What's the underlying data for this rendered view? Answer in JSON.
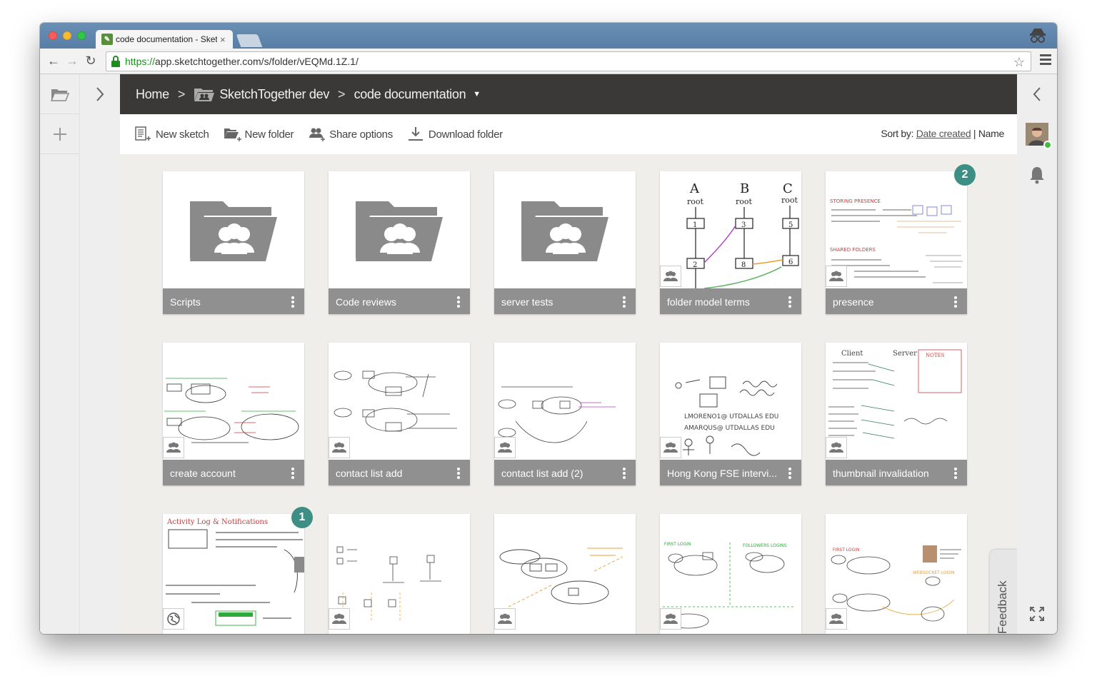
{
  "browser": {
    "tab_title": "code documentation - Sketc",
    "tab_close": "×",
    "url_scheme": "https://",
    "url_rest": "app.sketchtogether.com/s/folder/vEQMd.1Z.1/",
    "star": "☆"
  },
  "breadcrumb": {
    "home": "Home",
    "sep": ">",
    "folder": "SketchTogether dev",
    "current": "code documentation"
  },
  "actions": {
    "new_sketch": "New sketch",
    "new_folder": "New folder",
    "share_options": "Share options",
    "download_folder": "Download folder"
  },
  "sort": {
    "label": "Sort by:",
    "date_created": "Date created",
    "divider": "|",
    "name": "Name"
  },
  "cards": [
    {
      "label": "Scripts",
      "kind": "folder"
    },
    {
      "label": "Code reviews",
      "kind": "folder"
    },
    {
      "label": "server tests",
      "kind": "folder"
    },
    {
      "label": "folder model terms",
      "kind": "sketch"
    },
    {
      "label": "presence",
      "kind": "sketch",
      "badge": "2"
    },
    {
      "label": "create account",
      "kind": "sketch"
    },
    {
      "label": "contact list add",
      "kind": "sketch"
    },
    {
      "label": "contact list add (2)",
      "kind": "sketch"
    },
    {
      "label": "Hong Kong FSE intervi...",
      "kind": "sketch"
    },
    {
      "label": "thumbnail invalidation",
      "kind": "sketch"
    },
    {
      "label": "",
      "kind": "sketch",
      "badge": "1"
    },
    {
      "label": "",
      "kind": "sketch"
    },
    {
      "label": "",
      "kind": "sketch"
    },
    {
      "label": "",
      "kind": "sketch"
    },
    {
      "label": "",
      "kind": "sketch"
    }
  ],
  "sketch_text": {
    "a": "A",
    "b": "B",
    "c": "C",
    "root": "root",
    "n1": "1",
    "n2": "2",
    "n3": "3",
    "n5": "5",
    "n6": "6",
    "n8": "8",
    "storing_presence": "STORING PRESENCE",
    "shared_folders": "SHARED FOLDERS",
    "activity_log": "Activity Log & Notifications",
    "client": "Client",
    "server": "Server",
    "notes": "NOTES",
    "first_login": "FIRST LOGIN",
    "followers_logins": "FOLLOWERS LOGINS",
    "websocket_login": "WEBSOCKET LOGIN",
    "hk_line1": "LMORENO1@ UTDALLAS EDU",
    "hk_line2": "AMARQUS@ UTDALLAS EDU"
  },
  "feedback": "Feedback"
}
